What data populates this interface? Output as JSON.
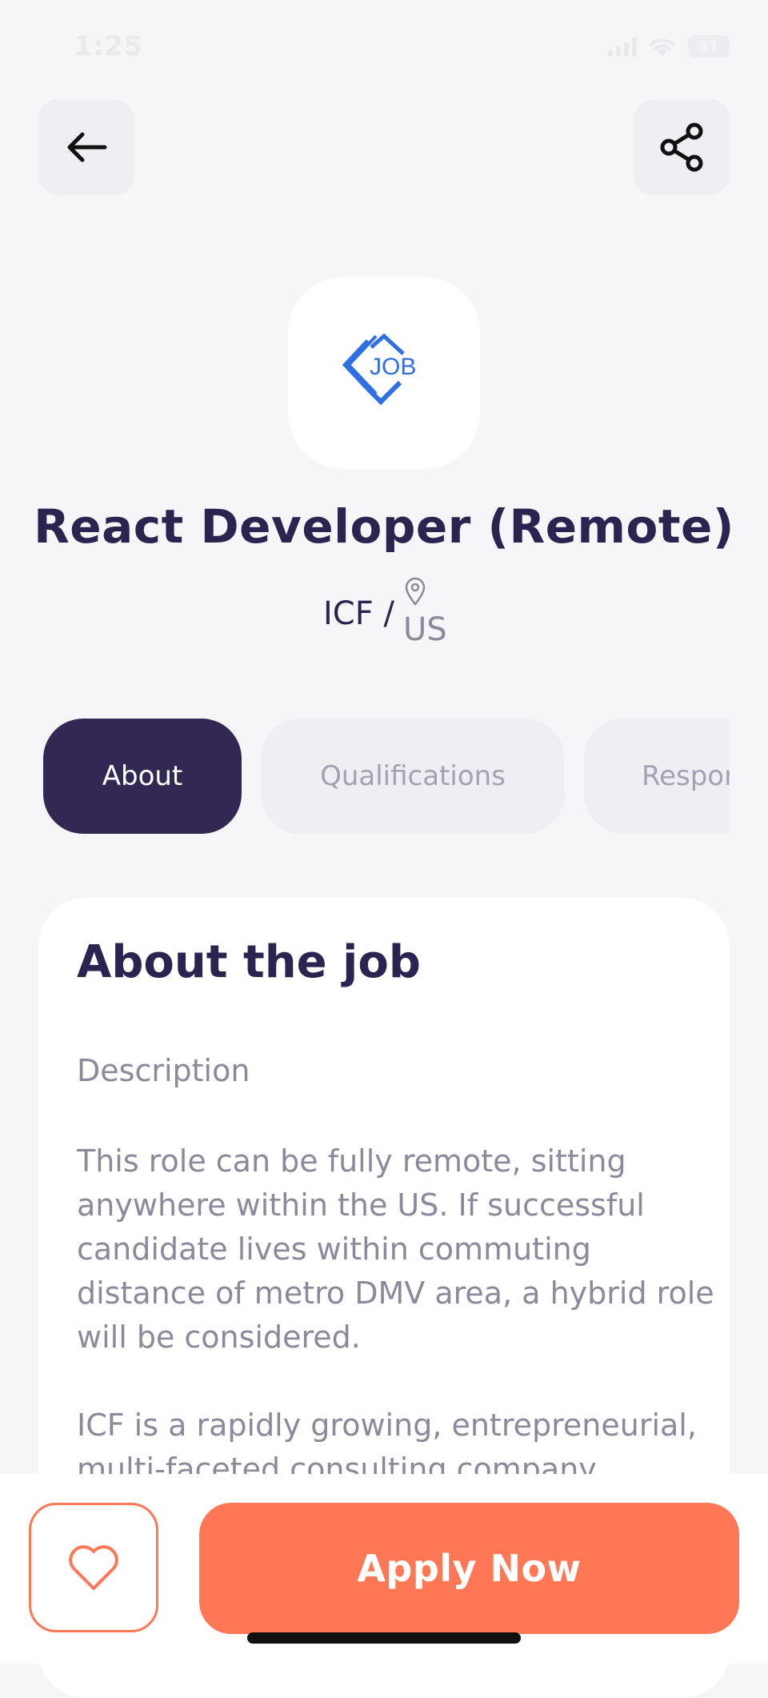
{
  "status_bar": {
    "time": "1:25",
    "battery": "51"
  },
  "nav": {
    "back_icon": "arrow-left-icon",
    "share_icon": "share-icon"
  },
  "company_logo": {
    "text": "JOB",
    "color": "#2F6FE4"
  },
  "job": {
    "title": "React Developer (Remote)",
    "company": "ICF /",
    "location": "US"
  },
  "tabs": [
    {
      "label": "About",
      "active": true
    },
    {
      "label": "Qualifications",
      "active": false
    },
    {
      "label": "Responsibilities",
      "active": false
    }
  ],
  "about": {
    "heading": "About the job",
    "subheading": "Description",
    "body": "This role can be fully remote, sitting anywhere within the US. If successful candidate lives within commuting distance of metro DMV area, a hybrid role will be considered.\n\nICF is a rapidly growing, entrepreneurial, multi-faceted consulting company."
  },
  "footer": {
    "favorite_icon": "heart-icon",
    "apply_label": "Apply Now"
  },
  "colors": {
    "primary": "#322853",
    "accent": "#FF7754",
    "background": "#F6F6F8"
  }
}
